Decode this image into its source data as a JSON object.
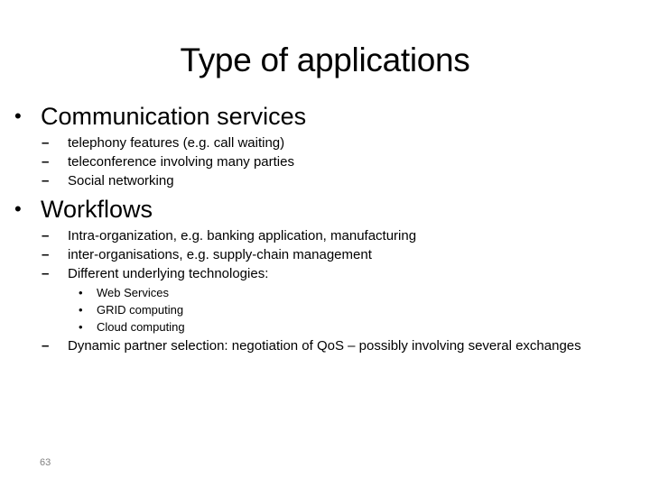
{
  "slide": {
    "title": "Type of applications",
    "page_number": "63",
    "sections": [
      {
        "heading": "Communication services",
        "items": [
          "telephony features (e.g. call waiting)",
          "teleconference involving many parties",
          "Social networking"
        ]
      },
      {
        "heading": "Workflows",
        "items": [
          "Intra-organization, e.g. banking application, manufacturing",
          "inter-organisations, e.g. supply-chain management",
          "Different underlying technologies:",
          "Dynamic partner selection: negotiation of QoS – possibly involving several exchanges"
        ],
        "subitems": [
          "Web Services",
          "GRID computing",
          "Cloud computing"
        ]
      }
    ],
    "bullet_glyph": "•",
    "dash_glyph": "–"
  }
}
